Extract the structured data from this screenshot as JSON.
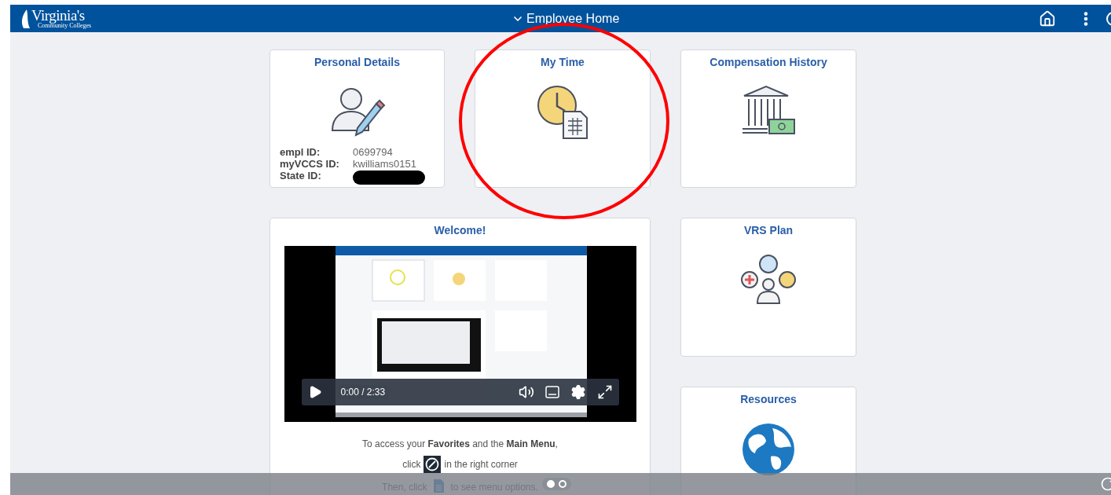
{
  "header": {
    "logo_title": "Virginia's",
    "logo_subtitle": "Community Colleges",
    "title": "Employee Home"
  },
  "tiles": [
    {
      "kind": "personal",
      "title": "Personal Details",
      "fields": [
        {
          "label": "empl ID:",
          "value": "0699794",
          "redacted": false
        },
        {
          "label": "myVCCS ID:",
          "value": "kwilliams0151",
          "redacted": false
        },
        {
          "label": "State ID:",
          "redacted": true
        }
      ]
    },
    {
      "kind": "time",
      "title": "My Time"
    },
    {
      "kind": "compensation",
      "title": "Compensation History"
    },
    {
      "kind": "welcome",
      "title": "Welcome!",
      "video": {
        "time": "0:00 / 2:33"
      },
      "lines": [
        {
          "before": "To access your **Favorites** and the **Main Menu**,"
        },
        {
          "before": "click",
          "after": "in the right corner"
        },
        {
          "before": "Then, click",
          "after": "to see menu options."
        }
      ]
    },
    {
      "kind": "vrs",
      "title": "VRS Plan"
    },
    {
      "kind": "resources",
      "title": "Resources"
    }
  ],
  "pager": [
    {
      "selected": true
    },
    {
      "selected": false
    }
  ],
  "annotation": {
    "kind": "ellipse"
  }
}
